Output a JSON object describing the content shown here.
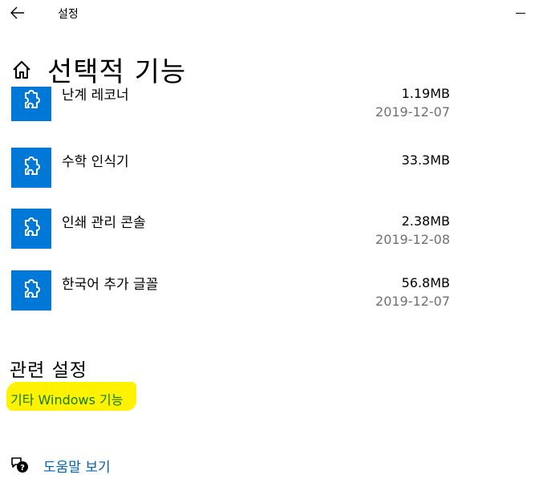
{
  "window": {
    "title": "설정"
  },
  "header": {
    "title": "선택적 기능"
  },
  "features": [
    {
      "name": "난계 레코너",
      "size": "1.19MB",
      "date": "2019-12-07"
    },
    {
      "name": "수학 인식기",
      "size": "33.3MB",
      "date": ""
    },
    {
      "name": "인쇄 관리 콘솔",
      "size": "2.38MB",
      "date": "2019-12-08"
    },
    {
      "name": "한국어 추가 글꼴",
      "size": "56.8MB",
      "date": "2019-12-07"
    }
  ],
  "related": {
    "heading": "관련 설정",
    "link_label": "기타 Windows 기능"
  },
  "help": {
    "label": "도움말 보기"
  },
  "colors": {
    "tile": "#0078d7",
    "highlight": "#fff200",
    "link_green": "#107c10",
    "link_blue": "#0063b1",
    "date_gray": "#707070"
  },
  "icons": {
    "back": "back-arrow-icon",
    "home": "home-icon",
    "feature": "puzzle-piece-icon",
    "help": "help-chat-icon"
  }
}
